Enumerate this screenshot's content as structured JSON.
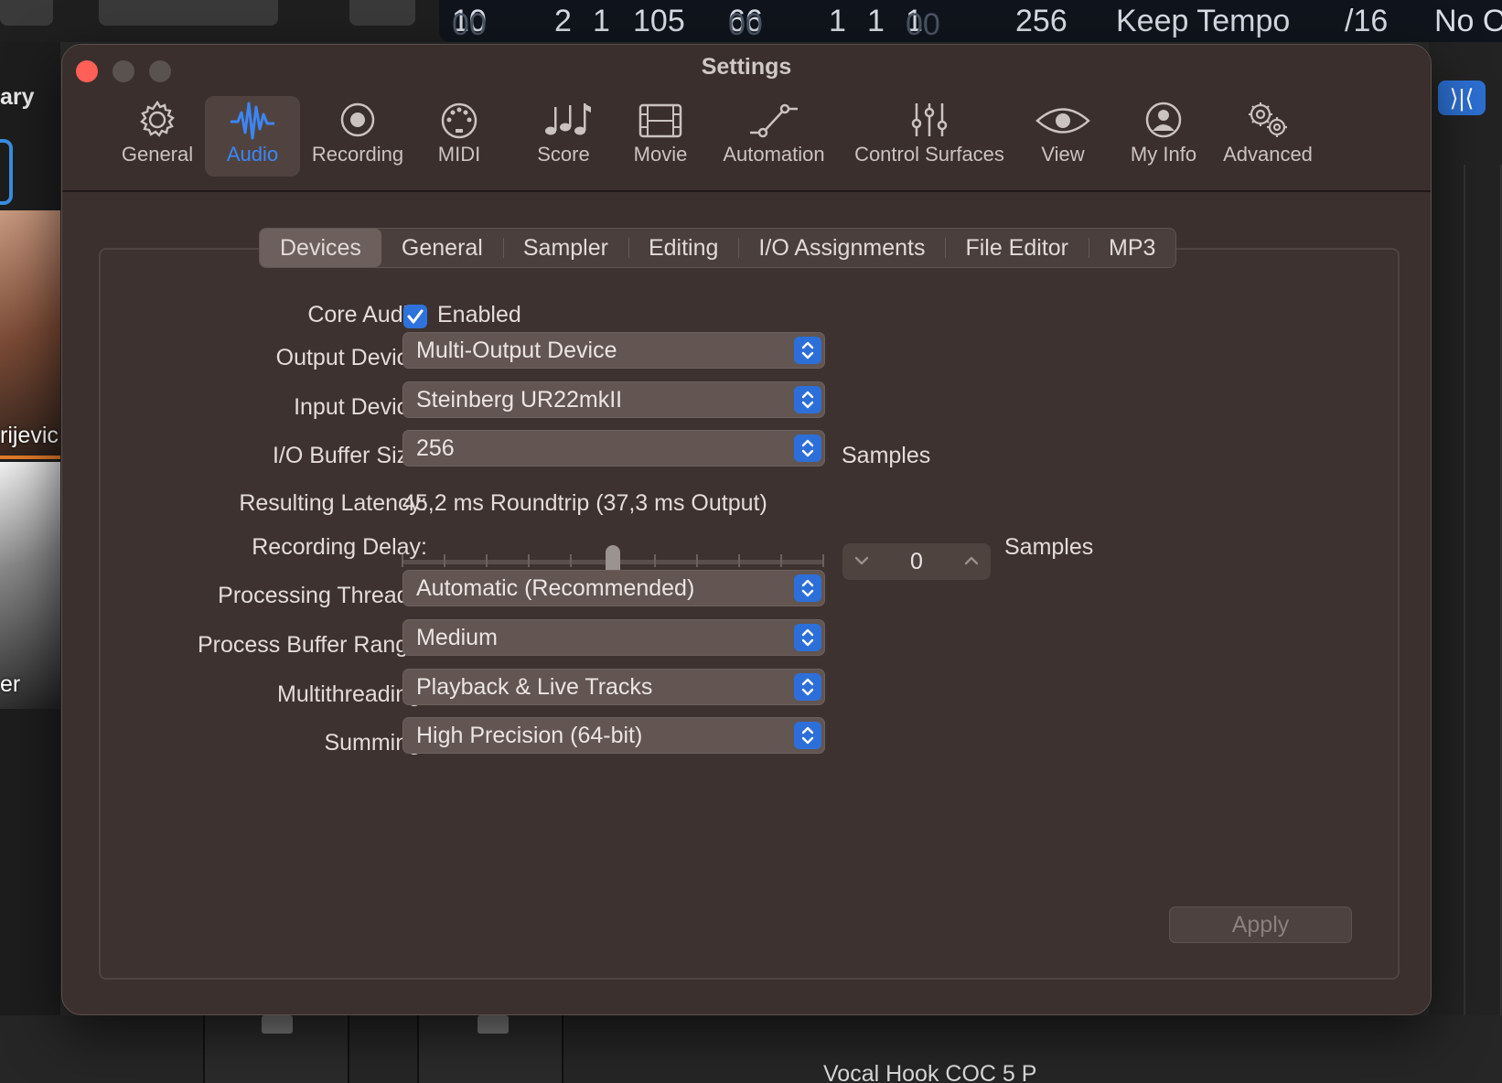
{
  "background": {
    "lcd": {
      "bar_dim": "00",
      "bar": "10",
      "beat": "2",
      "div": "1",
      "tick": "105",
      "b2_dim": "00",
      "b2": "66",
      "b2_beat": "1",
      "b2_div": "1",
      "b2_tick_dim": "00",
      "b2_tick": "1",
      "tempo": "256",
      "mode": "Keep Tempo",
      "division": "/16",
      "no_out": "No Ou"
    },
    "library_label": "ary",
    "video_name_1": "rijevic",
    "video_name_2": "er",
    "track_name": "Vocal Hook COC 5 P"
  },
  "window": {
    "title": "Settings",
    "toolbar": [
      {
        "label": "General",
        "icon": "gear-icon"
      },
      {
        "label": "Audio",
        "icon": "waveform-icon"
      },
      {
        "label": "Recording",
        "icon": "record-icon"
      },
      {
        "label": "MIDI",
        "icon": "midi-port-icon"
      },
      {
        "label": "Score",
        "icon": "music-notes-icon"
      },
      {
        "label": "Movie",
        "icon": "film-icon"
      },
      {
        "label": "Automation",
        "icon": "automation-icon"
      },
      {
        "label": "Control Surfaces",
        "icon": "faders-icon"
      },
      {
        "label": "View",
        "icon": "eye-icon"
      },
      {
        "label": "My Info",
        "icon": "person-icon"
      },
      {
        "label": "Advanced",
        "icon": "gears-icon"
      }
    ],
    "active_tool": "Audio",
    "tabs": [
      "Devices",
      "General",
      "Sampler",
      "Editing",
      "I/O Assignments",
      "File Editor",
      "MP3"
    ],
    "selected_tab": "Devices",
    "fields": {
      "core_audio_label": "Core Audio:",
      "core_audio_value": "Enabled",
      "core_audio_checked": true,
      "output_label": "Output Device:",
      "output_value": "Multi-Output Device",
      "input_label": "Input Device:",
      "input_value": "Steinberg UR22mkII",
      "buffer_label": "I/O Buffer Size:",
      "buffer_value": "256",
      "buffer_unit": "Samples",
      "latency_label": "Resulting Latency:",
      "latency_value": "45,2 ms Roundtrip (37,3 ms Output)",
      "delay_label": "Recording Delay:",
      "delay_value": "0",
      "delay_unit": "Samples",
      "delay_slider_fraction": 0.5,
      "threads_label": "Processing Threads:",
      "threads_value": "Automatic (Recommended)",
      "range_label": "Process Buffer Range:",
      "range_value": "Medium",
      "multithreading_label": "Multithreading:",
      "multithreading_value": "Playback & Live Tracks",
      "summing_label": "Summing:",
      "summing_value": "High Precision (64-bit)"
    },
    "apply_label": "Apply"
  },
  "colors": {
    "accent": "#3b86f7",
    "close": "#fe5f57",
    "window_bg": "#3c302e"
  }
}
